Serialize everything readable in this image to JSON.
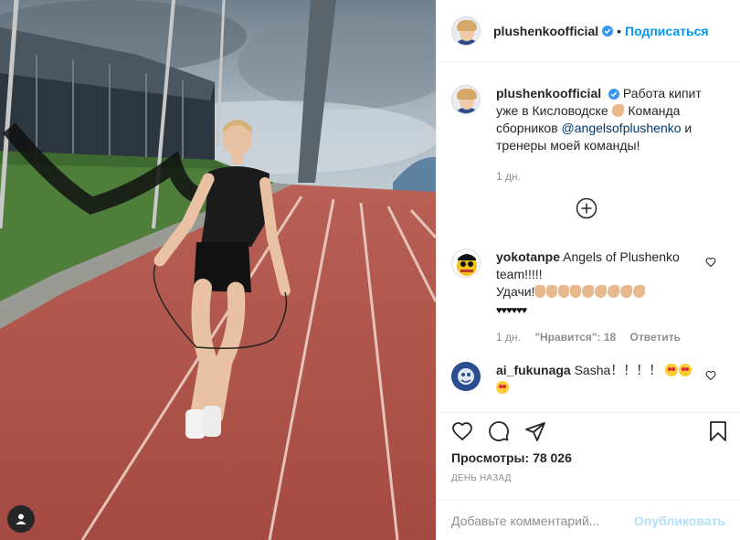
{
  "header": {
    "username": "plushenkoofficial",
    "separator": "•",
    "follow_label": "Подписаться"
  },
  "caption": {
    "username": "plushenkoofficial",
    "text_part1": "Работа кипит уже в Кисловодске",
    "text_part2": "Команда сборников",
    "mention": "@angelsofplushenko",
    "text_part3": "и тренеры моей команды!",
    "time": "1 дн."
  },
  "comments": [
    {
      "username": "yokotanpe",
      "text_part1": "Angels of Plushenko team!!!!!",
      "text_part2": "Удачи!",
      "time": "1 дн.",
      "likes": "\"Нравится\": 18",
      "reply": "Ответить"
    },
    {
      "username": "ai_fukunaga",
      "text_part1": "Sasha",
      "text_part2": "！！！！"
    }
  ],
  "stats": {
    "views_label": "Просмотры:",
    "views_value": "78 026",
    "date": "День назад"
  },
  "add_comment": {
    "placeholder": "Добавьте комментарий...",
    "post_label": "Опубликовать"
  },
  "icons": {
    "verified": "verified-badge-icon",
    "heart": "heart-icon",
    "comment": "comment-icon",
    "share": "share-icon",
    "bookmark": "bookmark-icon",
    "load_more": "plus-circle-icon",
    "user_tag": "user-tag-icon"
  },
  "colors": {
    "accent": "#0095f6",
    "post_disabled": "#b2dffc",
    "mention": "#00376b",
    "track": "#b05248"
  }
}
